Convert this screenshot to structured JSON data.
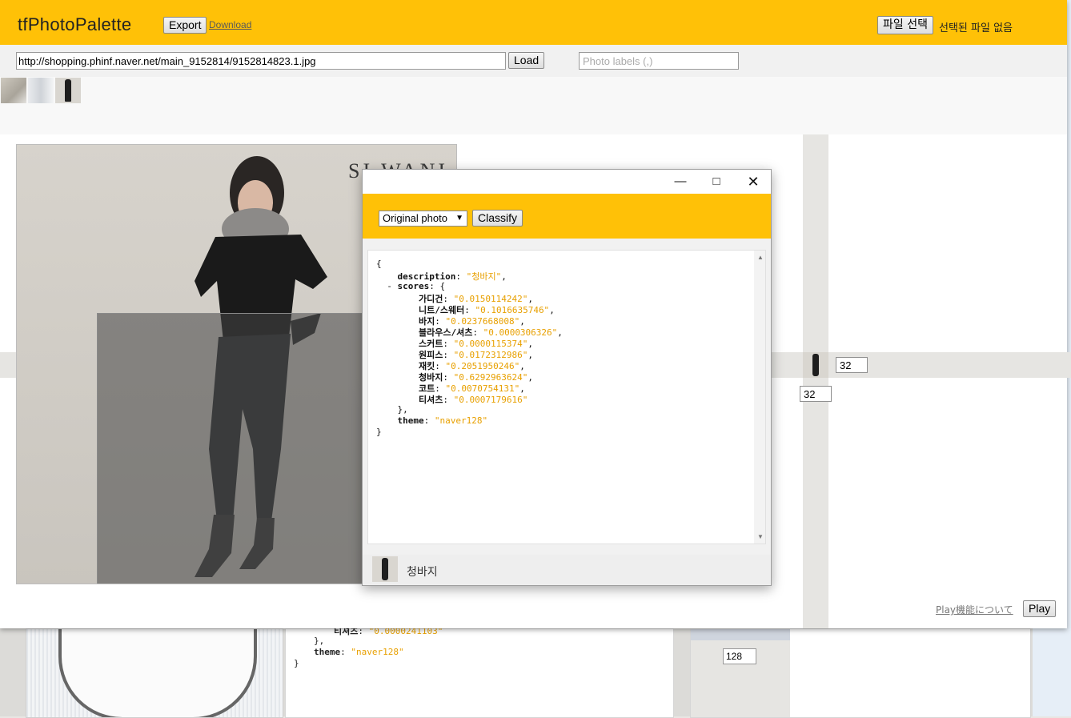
{
  "header": {
    "app_title": "tfPhotoPalette",
    "export_label": "Export",
    "download_label": "Download",
    "file_button_label": "파일 선택",
    "file_status": "선택된 파일 없음"
  },
  "url_bar": {
    "url_value": "http://shopping.phinf.naver.net/main_9152814/9152814823.1.jpg",
    "load_label": "Load",
    "labels_placeholder": "Photo labels (,)"
  },
  "photo": {
    "brand_text": "SI WANI"
  },
  "side": {
    "size_value_1": "32",
    "size_value_2": "32",
    "play_info_link": "Play機能について",
    "play_label": "Play"
  },
  "dialog": {
    "mode_selected": "Original photo",
    "classify_label": "Classify",
    "json_lines": [
      {
        "indent": "",
        "text": "{"
      },
      {
        "indent": "    ",
        "key": "description",
        "value": "\"청바지\"",
        "suffix": ","
      },
      {
        "indent": "  - ",
        "key": "scores",
        "rest": ": {"
      },
      {
        "indent": "        ",
        "key": "가디건",
        "value": "\"0.0150114242\"",
        "suffix": ","
      },
      {
        "indent": "        ",
        "key": "니트/스웨터",
        "value": "\"0.1016635746\"",
        "suffix": ","
      },
      {
        "indent": "        ",
        "key": "바지",
        "value": "\"0.0237668008\"",
        "suffix": ","
      },
      {
        "indent": "        ",
        "key": "블라우스/셔츠",
        "value": "\"0.0000306326\"",
        "suffix": ","
      },
      {
        "indent": "        ",
        "key": "스커트",
        "value": "\"0.0000115374\"",
        "suffix": ","
      },
      {
        "indent": "        ",
        "key": "원피스",
        "value": "\"0.0172312986\"",
        "suffix": ","
      },
      {
        "indent": "        ",
        "key": "재킷",
        "value": "\"0.2051950246\"",
        "suffix": ","
      },
      {
        "indent": "        ",
        "key": "청바지",
        "value": "\"0.6292963624\"",
        "suffix": ","
      },
      {
        "indent": "        ",
        "key": "코트",
        "value": "\"0.0070754131\"",
        "suffix": ","
      },
      {
        "indent": "        ",
        "key": "티셔츠",
        "value": "\"0.0007179616\""
      },
      {
        "indent": "    ",
        "text": "},"
      },
      {
        "indent": "    ",
        "key": "theme",
        "value": "\"naver128\""
      },
      {
        "indent": "",
        "text": "}"
      }
    ],
    "footer_label": "청바지"
  },
  "background_page": {
    "code_partial_key": "티셔츠",
    "code_partial_value": "\"0.0000241103\"",
    "code_close": "},",
    "code_theme_key": "theme",
    "code_theme_value": "\"naver128\"",
    "code_end": "}",
    "size_value_3": "128"
  },
  "colors": {
    "accent": "#ffc107",
    "json_string": "#e8a000"
  }
}
